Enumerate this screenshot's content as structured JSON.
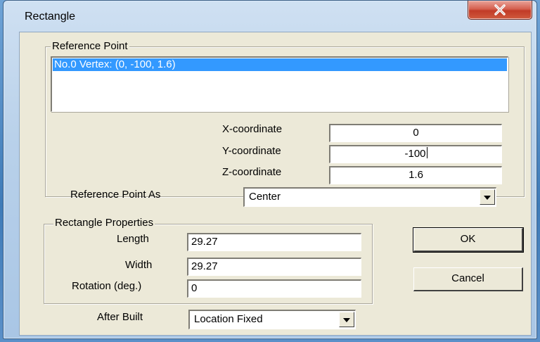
{
  "window": {
    "title": "Rectangle"
  },
  "reference_point": {
    "group_label": "Reference Point",
    "list_items": [
      "No.0 Vertex: (0, -100, 1.6)"
    ],
    "x_label": "X-coordinate",
    "x_value": "0",
    "y_label": "Y-coordinate",
    "y_value": "-100",
    "z_label": "Z-coordinate",
    "z_value": "1.6",
    "as_label": "Reference Point As",
    "as_value": "Center"
  },
  "rectangle_properties": {
    "group_label": "Rectangle Properties",
    "length_label": "Length",
    "length_value": "29.27",
    "width_label": "Width",
    "width_value": "29.27",
    "rotation_label": "Rotation (deg.)",
    "rotation_value": "0"
  },
  "after_built": {
    "label": "After Built",
    "value": "Location Fixed"
  },
  "buttons": {
    "ok": "OK",
    "cancel": "Cancel"
  },
  "icons": {
    "close": "close-x-icon",
    "dropdown": "chevron-down-icon"
  }
}
